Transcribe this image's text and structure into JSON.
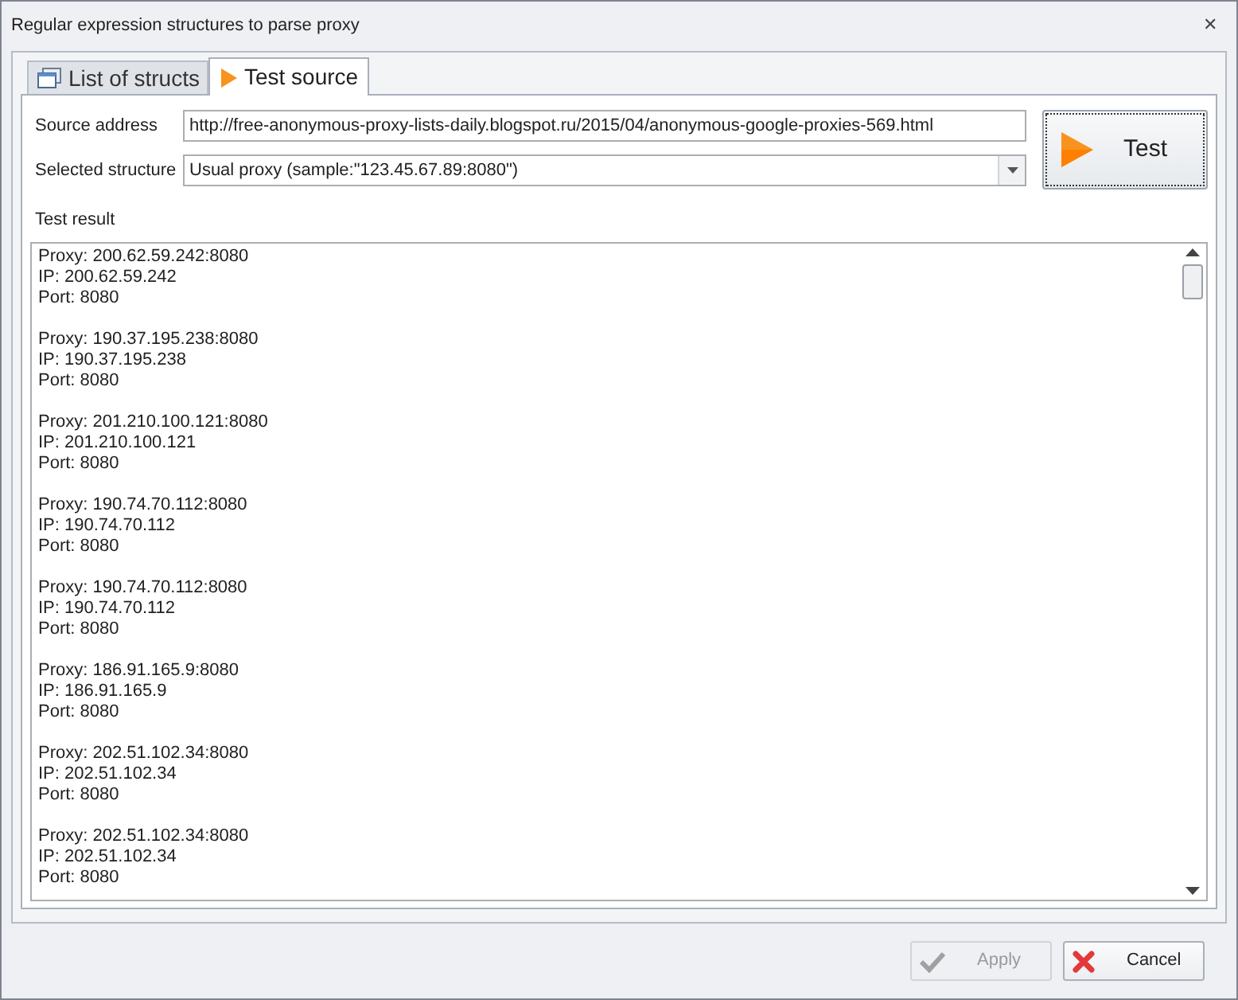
{
  "window": {
    "title": "Regular expression structures to parse proxy",
    "close": "✕"
  },
  "tabs": [
    {
      "label": "List of structs",
      "selected": false,
      "kind": "table"
    },
    {
      "label": "Test source",
      "selected": true,
      "kind": "play"
    }
  ],
  "source_address": {
    "label": "Source address",
    "value": "http://free-anonymous-proxy-lists-daily.blogspot.ru/2015/04/anonymous-google-proxies-569.html"
  },
  "selected_structure": {
    "label": "Selected structure",
    "value": "Usual proxy (sample:\"123.45.67.89:8080\")"
  },
  "test_button": {
    "label": "Test"
  },
  "test_result": {
    "label": "Test result",
    "entries": [
      [
        "Proxy: 200.62.59.242:8080",
        "IP: 200.62.59.242",
        "Port: 8080"
      ],
      [
        "Proxy: 190.37.195.238:8080",
        "IP: 190.37.195.238",
        "Port: 8080"
      ],
      [
        "Proxy: 201.210.100.121:8080",
        "IP: 201.210.100.121",
        "Port: 8080"
      ],
      [
        "Proxy: 190.74.70.112:8080",
        "IP: 190.74.70.112",
        "Port: 8080"
      ],
      [
        "Proxy: 190.74.70.112:8080",
        "IP: 190.74.70.112",
        "Port: 8080"
      ],
      [
        "Proxy: 186.91.165.9:8080",
        "IP: 186.91.165.9",
        "Port: 8080"
      ],
      [
        "Proxy: 202.51.102.34:8080",
        "IP: 202.51.102.34",
        "Port: 8080"
      ],
      [
        "Proxy: 202.51.102.34:8080",
        "IP: 202.51.102.34",
        "Port: 8080"
      ]
    ]
  },
  "buttons": [
    {
      "label": "Apply",
      "kind": "apply",
      "disabled": true
    },
    {
      "label": "Cancel",
      "kind": "cancel",
      "disabled": false
    }
  ]
}
